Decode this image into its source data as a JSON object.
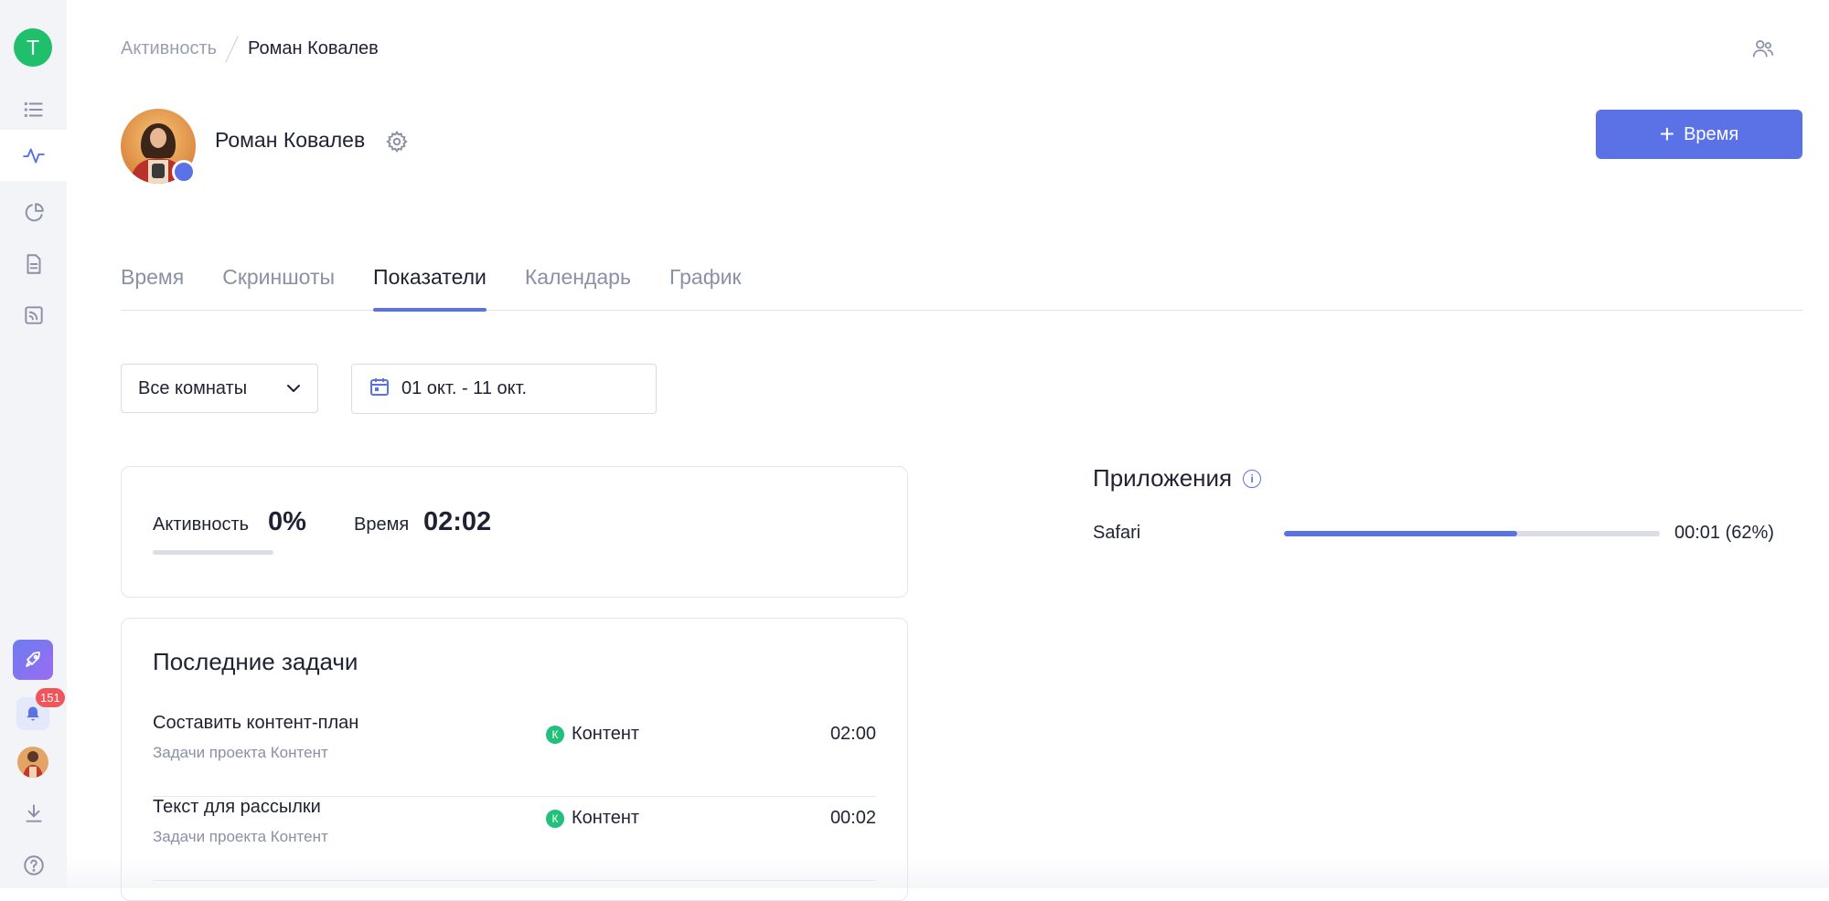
{
  "sidebar": {
    "workspace_letter": "T",
    "nav_items": [
      "tasks-list-icon",
      "activity-icon",
      "reports-pie-icon",
      "document-icon",
      "feed-icon"
    ],
    "notifications_count": "151"
  },
  "breadcrumb": {
    "root": "Активность",
    "current": "Роман Ковалев"
  },
  "profile": {
    "name": "Роман Ковалев",
    "status_color": "#5b72e6"
  },
  "actions": {
    "add_time_label": "Время"
  },
  "tabs": [
    {
      "label": "Время",
      "active": false
    },
    {
      "label": "Скриншоты",
      "active": false
    },
    {
      "label": "Показатели",
      "active": true
    },
    {
      "label": "Календарь",
      "active": false
    },
    {
      "label": "График",
      "active": false
    }
  ],
  "filters": {
    "room": "Все комнаты",
    "date_range": "01 окт. - 11 окт."
  },
  "summary": {
    "activity_label": "Активность",
    "activity_value": "0%",
    "activity_fraction": 0,
    "time_label": "Время",
    "time_value": "02:02"
  },
  "tasks": {
    "title": "Последние задачи",
    "rows": [
      {
        "name": "Составить контент-план",
        "subtitle": "Задачи проекта Контент",
        "project_letter": "К",
        "project": "Контент",
        "time": "02:00"
      },
      {
        "name": "Текст для рассылки",
        "subtitle": "Задачи проекта Контент",
        "project_letter": "К",
        "project": "Контент",
        "time": "00:02"
      }
    ]
  },
  "apps": {
    "title": "Приложения",
    "items": [
      {
        "name": "Safari",
        "fraction": 0.62,
        "value": "00:01 (62%)"
      }
    ]
  },
  "colors": {
    "accent": "#5b72e6",
    "project_green": "#22c07a",
    "workspace_green": "#1fbf6b",
    "badge_red": "#f0555a"
  }
}
